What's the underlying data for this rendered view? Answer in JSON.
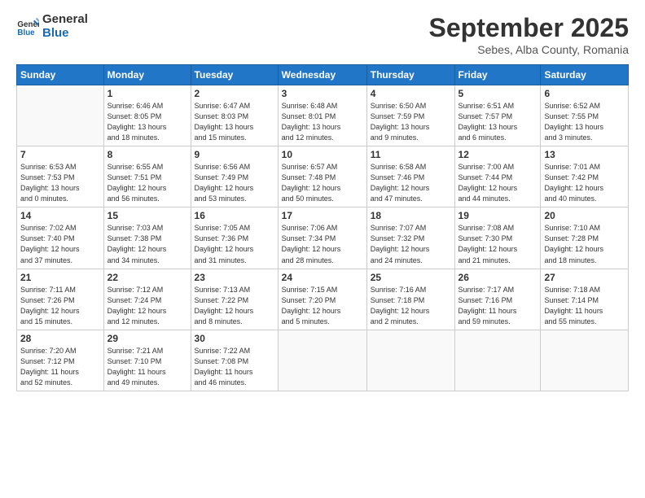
{
  "logo": {
    "line1": "General",
    "line2": "Blue"
  },
  "title": "September 2025",
  "subtitle": "Sebes, Alba County, Romania",
  "days_of_week": [
    "Sunday",
    "Monday",
    "Tuesday",
    "Wednesday",
    "Thursday",
    "Friday",
    "Saturday"
  ],
  "weeks": [
    [
      {
        "day": "",
        "info": ""
      },
      {
        "day": "1",
        "info": "Sunrise: 6:46 AM\nSunset: 8:05 PM\nDaylight: 13 hours\nand 18 minutes."
      },
      {
        "day": "2",
        "info": "Sunrise: 6:47 AM\nSunset: 8:03 PM\nDaylight: 13 hours\nand 15 minutes."
      },
      {
        "day": "3",
        "info": "Sunrise: 6:48 AM\nSunset: 8:01 PM\nDaylight: 13 hours\nand 12 minutes."
      },
      {
        "day": "4",
        "info": "Sunrise: 6:50 AM\nSunset: 7:59 PM\nDaylight: 13 hours\nand 9 minutes."
      },
      {
        "day": "5",
        "info": "Sunrise: 6:51 AM\nSunset: 7:57 PM\nDaylight: 13 hours\nand 6 minutes."
      },
      {
        "day": "6",
        "info": "Sunrise: 6:52 AM\nSunset: 7:55 PM\nDaylight: 13 hours\nand 3 minutes."
      }
    ],
    [
      {
        "day": "7",
        "info": "Sunrise: 6:53 AM\nSunset: 7:53 PM\nDaylight: 13 hours\nand 0 minutes."
      },
      {
        "day": "8",
        "info": "Sunrise: 6:55 AM\nSunset: 7:51 PM\nDaylight: 12 hours\nand 56 minutes."
      },
      {
        "day": "9",
        "info": "Sunrise: 6:56 AM\nSunset: 7:49 PM\nDaylight: 12 hours\nand 53 minutes."
      },
      {
        "day": "10",
        "info": "Sunrise: 6:57 AM\nSunset: 7:48 PM\nDaylight: 12 hours\nand 50 minutes."
      },
      {
        "day": "11",
        "info": "Sunrise: 6:58 AM\nSunset: 7:46 PM\nDaylight: 12 hours\nand 47 minutes."
      },
      {
        "day": "12",
        "info": "Sunrise: 7:00 AM\nSunset: 7:44 PM\nDaylight: 12 hours\nand 44 minutes."
      },
      {
        "day": "13",
        "info": "Sunrise: 7:01 AM\nSunset: 7:42 PM\nDaylight: 12 hours\nand 40 minutes."
      }
    ],
    [
      {
        "day": "14",
        "info": "Sunrise: 7:02 AM\nSunset: 7:40 PM\nDaylight: 12 hours\nand 37 minutes."
      },
      {
        "day": "15",
        "info": "Sunrise: 7:03 AM\nSunset: 7:38 PM\nDaylight: 12 hours\nand 34 minutes."
      },
      {
        "day": "16",
        "info": "Sunrise: 7:05 AM\nSunset: 7:36 PM\nDaylight: 12 hours\nand 31 minutes."
      },
      {
        "day": "17",
        "info": "Sunrise: 7:06 AM\nSunset: 7:34 PM\nDaylight: 12 hours\nand 28 minutes."
      },
      {
        "day": "18",
        "info": "Sunrise: 7:07 AM\nSunset: 7:32 PM\nDaylight: 12 hours\nand 24 minutes."
      },
      {
        "day": "19",
        "info": "Sunrise: 7:08 AM\nSunset: 7:30 PM\nDaylight: 12 hours\nand 21 minutes."
      },
      {
        "day": "20",
        "info": "Sunrise: 7:10 AM\nSunset: 7:28 PM\nDaylight: 12 hours\nand 18 minutes."
      }
    ],
    [
      {
        "day": "21",
        "info": "Sunrise: 7:11 AM\nSunset: 7:26 PM\nDaylight: 12 hours\nand 15 minutes."
      },
      {
        "day": "22",
        "info": "Sunrise: 7:12 AM\nSunset: 7:24 PM\nDaylight: 12 hours\nand 12 minutes."
      },
      {
        "day": "23",
        "info": "Sunrise: 7:13 AM\nSunset: 7:22 PM\nDaylight: 12 hours\nand 8 minutes."
      },
      {
        "day": "24",
        "info": "Sunrise: 7:15 AM\nSunset: 7:20 PM\nDaylight: 12 hours\nand 5 minutes."
      },
      {
        "day": "25",
        "info": "Sunrise: 7:16 AM\nSunset: 7:18 PM\nDaylight: 12 hours\nand 2 minutes."
      },
      {
        "day": "26",
        "info": "Sunrise: 7:17 AM\nSunset: 7:16 PM\nDaylight: 11 hours\nand 59 minutes."
      },
      {
        "day": "27",
        "info": "Sunrise: 7:18 AM\nSunset: 7:14 PM\nDaylight: 11 hours\nand 55 minutes."
      }
    ],
    [
      {
        "day": "28",
        "info": "Sunrise: 7:20 AM\nSunset: 7:12 PM\nDaylight: 11 hours\nand 52 minutes."
      },
      {
        "day": "29",
        "info": "Sunrise: 7:21 AM\nSunset: 7:10 PM\nDaylight: 11 hours\nand 49 minutes."
      },
      {
        "day": "30",
        "info": "Sunrise: 7:22 AM\nSunset: 7:08 PM\nDaylight: 11 hours\nand 46 minutes."
      },
      {
        "day": "",
        "info": ""
      },
      {
        "day": "",
        "info": ""
      },
      {
        "day": "",
        "info": ""
      },
      {
        "day": "",
        "info": ""
      }
    ]
  ]
}
